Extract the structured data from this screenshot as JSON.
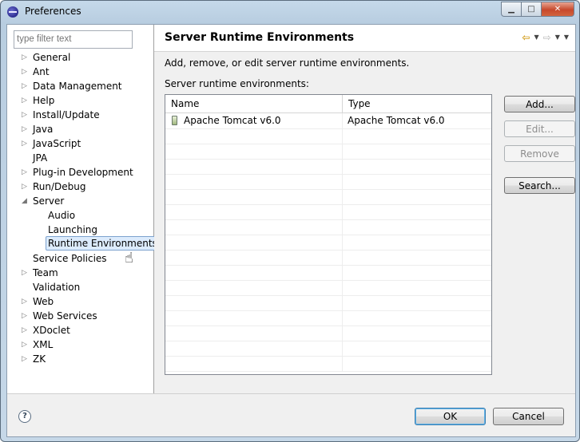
{
  "window": {
    "title": "Preferences"
  },
  "filter": {
    "placeholder": "type filter text"
  },
  "tree": [
    {
      "label": "General",
      "arrow": "▷",
      "indent": 0
    },
    {
      "label": "Ant",
      "arrow": "▷",
      "indent": 0
    },
    {
      "label": "Data Management",
      "arrow": "▷",
      "indent": 0
    },
    {
      "label": "Help",
      "arrow": "▷",
      "indent": 0
    },
    {
      "label": "Install/Update",
      "arrow": "▷",
      "indent": 0
    },
    {
      "label": "Java",
      "arrow": "▷",
      "indent": 0
    },
    {
      "label": "JavaScript",
      "arrow": "▷",
      "indent": 0
    },
    {
      "label": "JPA",
      "arrow": "",
      "indent": 0
    },
    {
      "label": "Plug-in Development",
      "arrow": "▷",
      "indent": 0
    },
    {
      "label": "Run/Debug",
      "arrow": "▷",
      "indent": 0
    },
    {
      "label": "Server",
      "arrow": "◢",
      "indent": 0
    },
    {
      "label": "Audio",
      "arrow": "",
      "indent": 1
    },
    {
      "label": "Launching",
      "arrow": "",
      "indent": 1
    },
    {
      "label": "Runtime Environments",
      "arrow": "",
      "indent": 1,
      "selected": true
    },
    {
      "label": "Service Policies",
      "arrow": "",
      "indent": 0
    },
    {
      "label": "Team",
      "arrow": "▷",
      "indent": 0
    },
    {
      "label": "Validation",
      "arrow": "",
      "indent": 0
    },
    {
      "label": "Web",
      "arrow": "▷",
      "indent": 0
    },
    {
      "label": "Web Services",
      "arrow": "▷",
      "indent": 0
    },
    {
      "label": "XDoclet",
      "arrow": "▷",
      "indent": 0
    },
    {
      "label": "XML",
      "arrow": "▷",
      "indent": 0
    },
    {
      "label": "ZK",
      "arrow": "▷",
      "indent": 0
    }
  ],
  "page": {
    "title": "Server Runtime Environments",
    "description": "Add, remove, or edit server runtime environments.",
    "list_label": "Server runtime environments:"
  },
  "table": {
    "columns": [
      "Name",
      "Type"
    ],
    "rows": [
      {
        "name": "Apache Tomcat v6.0",
        "type": "Apache Tomcat v6.0",
        "icon": "tomcat-server-icon"
      }
    ],
    "empty_rows": 16
  },
  "buttons": {
    "add": "Add...",
    "edit": "Edit...",
    "remove": "Remove",
    "search": "Search...",
    "ok": "OK",
    "cancel": "Cancel"
  },
  "icons": {
    "help": "?",
    "back": "⇦",
    "forward": "⇨",
    "dropdown": "▼",
    "minimize": "▁",
    "maximize": "□",
    "close": "✕"
  }
}
